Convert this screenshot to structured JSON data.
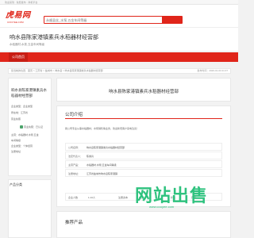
{
  "topbar": {
    "text": "欢迎来到 · 免费发布 · 商机平台"
  },
  "header": {
    "logo_text": "虎易网",
    "logo_sub": "COOYEE.COM",
    "search_placeholder": "永顺县丝_水泵,五金车间等级"
  },
  "company": {
    "name": "响水县陈家港镇素兵水稻器材经营部",
    "subtitle": "水稻器材,水泵,五金车间等级"
  },
  "nav": {
    "active_item": "公司首页"
  },
  "breadcrumb": {
    "text": "您当前的位置：首页 > 江苏省 > 盐城市 > 响水县 > 响水县陈家港镇素兵水稻器材经营部",
    "time": "发布时间：2020-01-03 21:07"
  },
  "sidebar": {
    "company_name": "响水县陈家港镇素兵水稻器材经营部",
    "rows": [
      "企业类型：企业类型",
      "所在地：江苏省",
      "营业执照"
    ],
    "status_label": "营业执照：已认证",
    "list": [
      "主营：水稻器材,水泵,五金",
      "车间等级",
      "企业类型：个体经营",
      "注册地址"
    ],
    "products_title": "产品分类"
  },
  "main": {
    "title": "响水县陈家港镇素兵水稻器材经营部",
    "intro_title": "公司介绍",
    "intro_text": "我公司专业从事水稻器材，水泵销售等业务，欢迎新老客户来电洽谈！",
    "info_rows": [
      {
        "label": "公司名称：",
        "value": "响水县陈家港镇素兵水稻器材经营部"
      },
      {
        "label": "法定代表人：",
        "value": "陈素兵"
      },
      {
        "label": "主营产品：",
        "value": "水稻器材,水泵,五金车间等级"
      },
      {
        "label": "注册地址：",
        "value": "江苏省盐城市响水县陈家港镇"
      }
    ],
    "prod_row": [
      {
        "label": "企业人数",
        "value": "1-10人"
      },
      {
        "label": "注册资本",
        "value": "5万"
      },
      {
        "label": "状态",
        "value": "存续"
      }
    ],
    "recommend_title": "推荐产品"
  },
  "watermark": {
    "text": "网站出售",
    "sub": "www.cooyee.com"
  },
  "colors": {
    "brand": "#e0251a",
    "status_green": "#4aa36a",
    "watermark_green": "#2ec27e"
  }
}
